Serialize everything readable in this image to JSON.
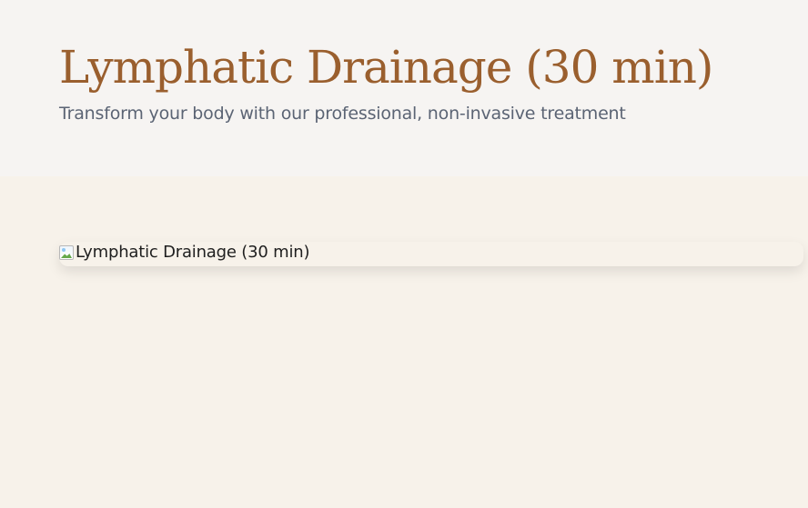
{
  "header": {
    "title": "Lymphatic Drainage (30 min)",
    "subtitle": "Transform your body with our professional, non-invasive treatment"
  },
  "main": {
    "image_alt": "Lymphatic Drainage (30 min)"
  },
  "colors": {
    "header_background": "#f6f4f2",
    "page_background": "#f7f2ea",
    "title": "#9a5f2e",
    "subtitle": "#5b6474"
  },
  "icons": {
    "broken_image": "broken-image-icon"
  }
}
